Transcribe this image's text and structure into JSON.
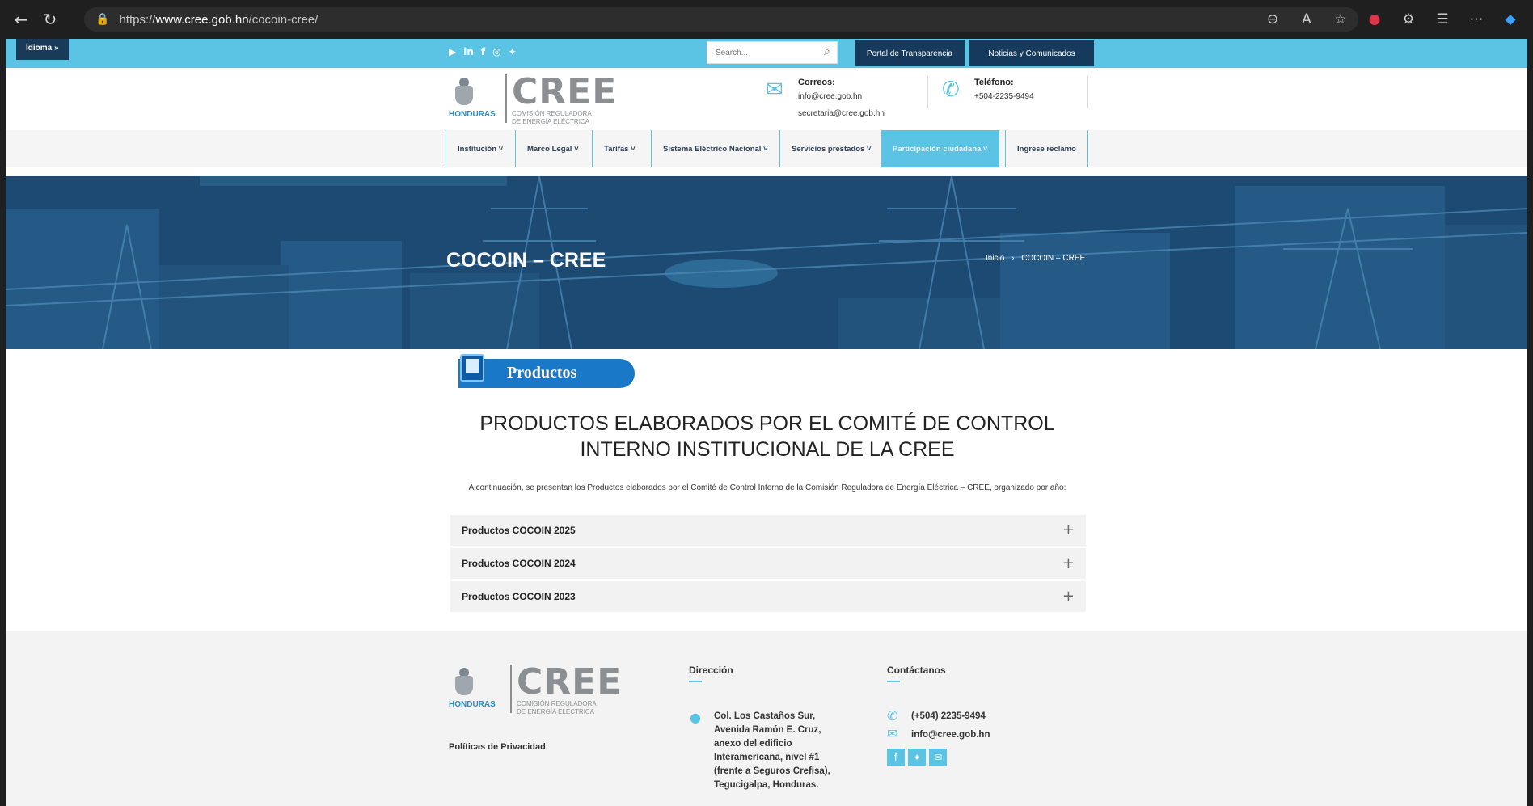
{
  "browser": {
    "url_prefix": "https://",
    "url_host": "www.cree.gob.hn",
    "url_path": "/cocoin-cree/"
  },
  "topbar": {
    "idioma": "Idioma »",
    "search_placeholder": "Search...",
    "portal_button": "Portal de Transparencia",
    "news_button": "Noticias y Comunicados"
  },
  "header": {
    "logo_country": "HONDURAS",
    "logo_word": "CREE",
    "logo_sub1": "COMISIÓN REGULADORA",
    "logo_sub2": "DE ENERGÍA ELÉCTRICA",
    "correos_title": "Correos:",
    "correo_1": "info@cree.gob.hn",
    "correo_2": "secretaria@cree.gob.hn",
    "telefono_title": "Teléfono:",
    "telefono": "+504-2235-9494"
  },
  "nav": {
    "items": [
      "Institución ˅",
      "Marco Legal ˅",
      "Tarifas ˅",
      "Sistema Eléctrico Nacional ˅",
      "Servicios prestados ˅",
      "Participación ciudadana ˅",
      "Ingrese reclamo"
    ]
  },
  "hero": {
    "title": "COCOIN – CREE",
    "crumb_home": "Inicio",
    "crumb_sep": "›",
    "crumb_current": "COCOIN – CREE"
  },
  "content": {
    "banner": "Productos",
    "headline_1": "PRODUCTOS ELABORADOS POR EL COMITÉ DE CONTROL",
    "headline_2": "INTERNO INSTITUCIONAL DE LA CREE",
    "intro": "A continuación, se presentan los Productos elaborados por el Comité de Control Interno de la Comisión Reguladora de Energía Eléctrica – CREE, organizado por año:",
    "accordion": [
      "Productos COCOIN 2025",
      "Productos COCOIN 2024",
      "Productos COCOIN 2023"
    ]
  },
  "footer": {
    "privacy": "Políticas de Privacidad",
    "direccion_title": "Dirección",
    "address": [
      "Col. Los Castaños Sur,",
      "Avenida Ramón E. Cruz,",
      "anexo del edificio",
      "Interamericana, nivel #1",
      "(frente a Seguros Crefisa),",
      "Tegucigalpa, Honduras."
    ],
    "contact_title": "Contáctanos",
    "phone": "(+504) 2235-9494",
    "email": "info@cree.gob.hn"
  },
  "colors": {
    "accent": "#5bc3e4",
    "navy": "#153a5b",
    "hero": "#1c4a72"
  }
}
